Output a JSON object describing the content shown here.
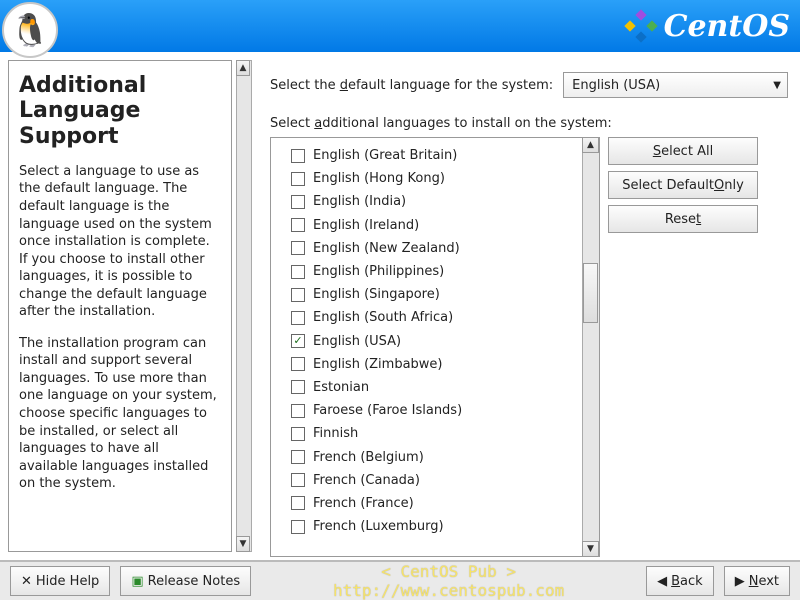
{
  "brand": "CentOS",
  "help": {
    "title": "Additional Language Support",
    "p1": "Select a language to use as the default language. The default language is the language used on the system once installation is complete. If you choose to install other languages, it is possible to change the default language after the installation.",
    "p2": "The installation program can install and support several languages. To use more than one language on your system, choose specific languages to be installed, or select all languages to have all available languages installed on the system."
  },
  "labels": {
    "default_lang_pre": "Select the ",
    "default_lang_u": "d",
    "default_lang_post": "efault language for the system:",
    "additional_pre": "Select ",
    "additional_u": "a",
    "additional_post": "dditional languages to install on the system:"
  },
  "default_language": "English (USA)",
  "languages": [
    {
      "name": "English (Great Britain)",
      "checked": false
    },
    {
      "name": "English (Hong Kong)",
      "checked": false
    },
    {
      "name": "English (India)",
      "checked": false
    },
    {
      "name": "English (Ireland)",
      "checked": false
    },
    {
      "name": "English (New Zealand)",
      "checked": false
    },
    {
      "name": "English (Philippines)",
      "checked": false
    },
    {
      "name": "English (Singapore)",
      "checked": false
    },
    {
      "name": "English (South Africa)",
      "checked": false
    },
    {
      "name": "English (USA)",
      "checked": true
    },
    {
      "name": "English (Zimbabwe)",
      "checked": false
    },
    {
      "name": "Estonian",
      "checked": false
    },
    {
      "name": "Faroese (Faroe Islands)",
      "checked": false
    },
    {
      "name": "Finnish",
      "checked": false
    },
    {
      "name": "French (Belgium)",
      "checked": false
    },
    {
      "name": "French (Canada)",
      "checked": false
    },
    {
      "name": "French (France)",
      "checked": false
    },
    {
      "name": "French (Luxemburg)",
      "checked": false
    }
  ],
  "buttons": {
    "select_all_pre": "",
    "select_all_u": "S",
    "select_all_post": "elect All",
    "select_default_pre": "Select Default ",
    "select_default_u": "O",
    "select_default_post": "nly",
    "reset_pre": "Rese",
    "reset_u": "t",
    "reset_post": "",
    "hide_help": "Hide Help",
    "release_notes": "Release Notes",
    "back_pre": "",
    "back_u": "B",
    "back_post": "ack",
    "next_pre": "",
    "next_u": "N",
    "next_post": "ext"
  },
  "watermark": "< CentOS Pub > http://www.centospub.com"
}
